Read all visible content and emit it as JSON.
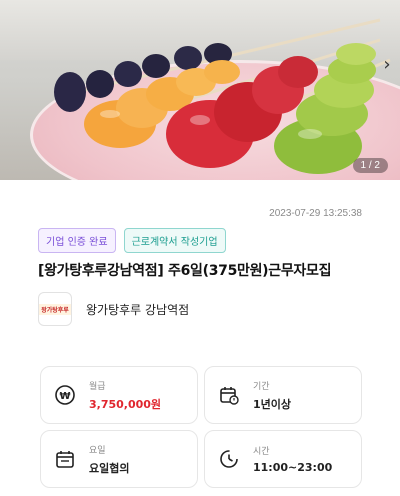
{
  "hero": {
    "page_indicator": "1 / 2",
    "next_icon": "chevron-right-icon"
  },
  "post": {
    "date": "2023-07-29 13:25:38",
    "badges": [
      "기업 인증 완료",
      "근로계약서 작성기업"
    ],
    "title": "[왕가탕후루강남역점] 주6일(375만원)근무자모집"
  },
  "company": {
    "logo_text": "왕가탕후루",
    "name": "왕가탕후루 강남역점"
  },
  "info": {
    "pay": {
      "label": "월급",
      "value": "3,750,000원",
      "icon": "won-icon"
    },
    "period": {
      "label": "기간",
      "value": "1년이상",
      "icon": "calendar-icon"
    },
    "days": {
      "label": "요일",
      "value": "요일협의",
      "icon": "calendar-list-icon"
    },
    "time": {
      "label": "시간",
      "value": "11:00~23:00",
      "icon": "clock-icon"
    }
  },
  "colors": {
    "pay_red": "#e0262e",
    "badge_purple": "#7a4fd8",
    "badge_teal": "#1d9e90"
  }
}
